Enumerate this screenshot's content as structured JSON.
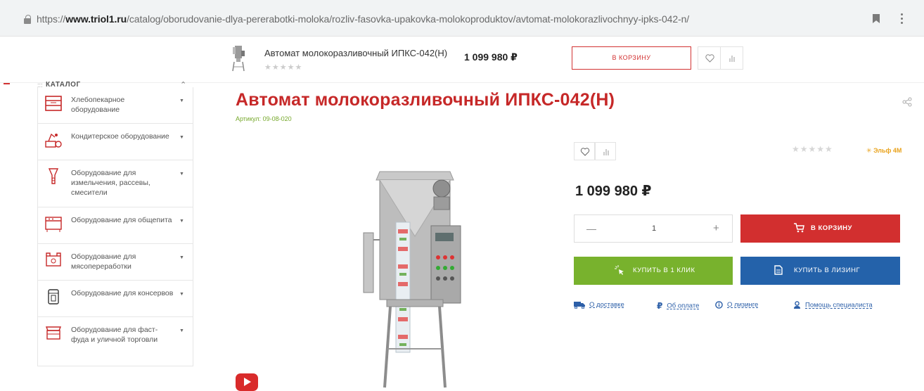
{
  "browser": {
    "url_prefix": "https://",
    "url_domain": "www.triol1.ru",
    "url_path": "/catalog/oborudovanie-dlya-pererabotki-moloka/rozliv-fasovka-upakovka-molokoproduktov/avtomat-molokorazlivochnyy-ipks-042-n/"
  },
  "sticky": {
    "title": "Автомат молокоразливочный ИПКС-042(Н)",
    "stars": "★★★★★",
    "price": "1 099 980 ₽",
    "cart_label": "в корзину"
  },
  "sidebar": {
    "heading": "КАТАЛОГ",
    "items": [
      {
        "label": "Хлебопекарное оборудование",
        "icon": "bakery-icon"
      },
      {
        "label": "Кондитерское оборудование",
        "icon": "confectionery-icon"
      },
      {
        "label": "Оборудование для измельчения, рассевы, смесители",
        "icon": "mill-icon"
      },
      {
        "label": "Оборудование для общепита",
        "icon": "catering-icon"
      },
      {
        "label": "Оборудование для мясопереработки",
        "icon": "meat-icon"
      },
      {
        "label": "Оборудование для консервов",
        "icon": "cans-icon"
      },
      {
        "label": "Оборудование для фаст-фуда и уличной торговли",
        "icon": "fastfood-icon"
      }
    ]
  },
  "product": {
    "title": "Автомат молокоразливочный ИПКС-042(Н)",
    "sku_label": "Артикул:",
    "sku_value": "09-08-020",
    "rating_stars": "★★★★★",
    "brand": "Эльф 4М",
    "price": "1 099 980 ₽",
    "quantity": "1",
    "cart_label": "в корзину",
    "oneclick_label": "купить в 1 клик",
    "leasing_label": "купить в лизинг"
  },
  "info_links": [
    {
      "label": "О доставке",
      "icon": "truck-icon"
    },
    {
      "label": "Об оплате",
      "icon": "ruble-icon"
    },
    {
      "label": "О лизинге",
      "icon": "info-icon"
    },
    {
      "label": "Помощь специалиста",
      "icon": "user-icon"
    }
  ],
  "colors": {
    "accent_red": "#d22f2f",
    "green": "#78b22d",
    "blue": "#2462aa",
    "title_red": "#c62828"
  }
}
